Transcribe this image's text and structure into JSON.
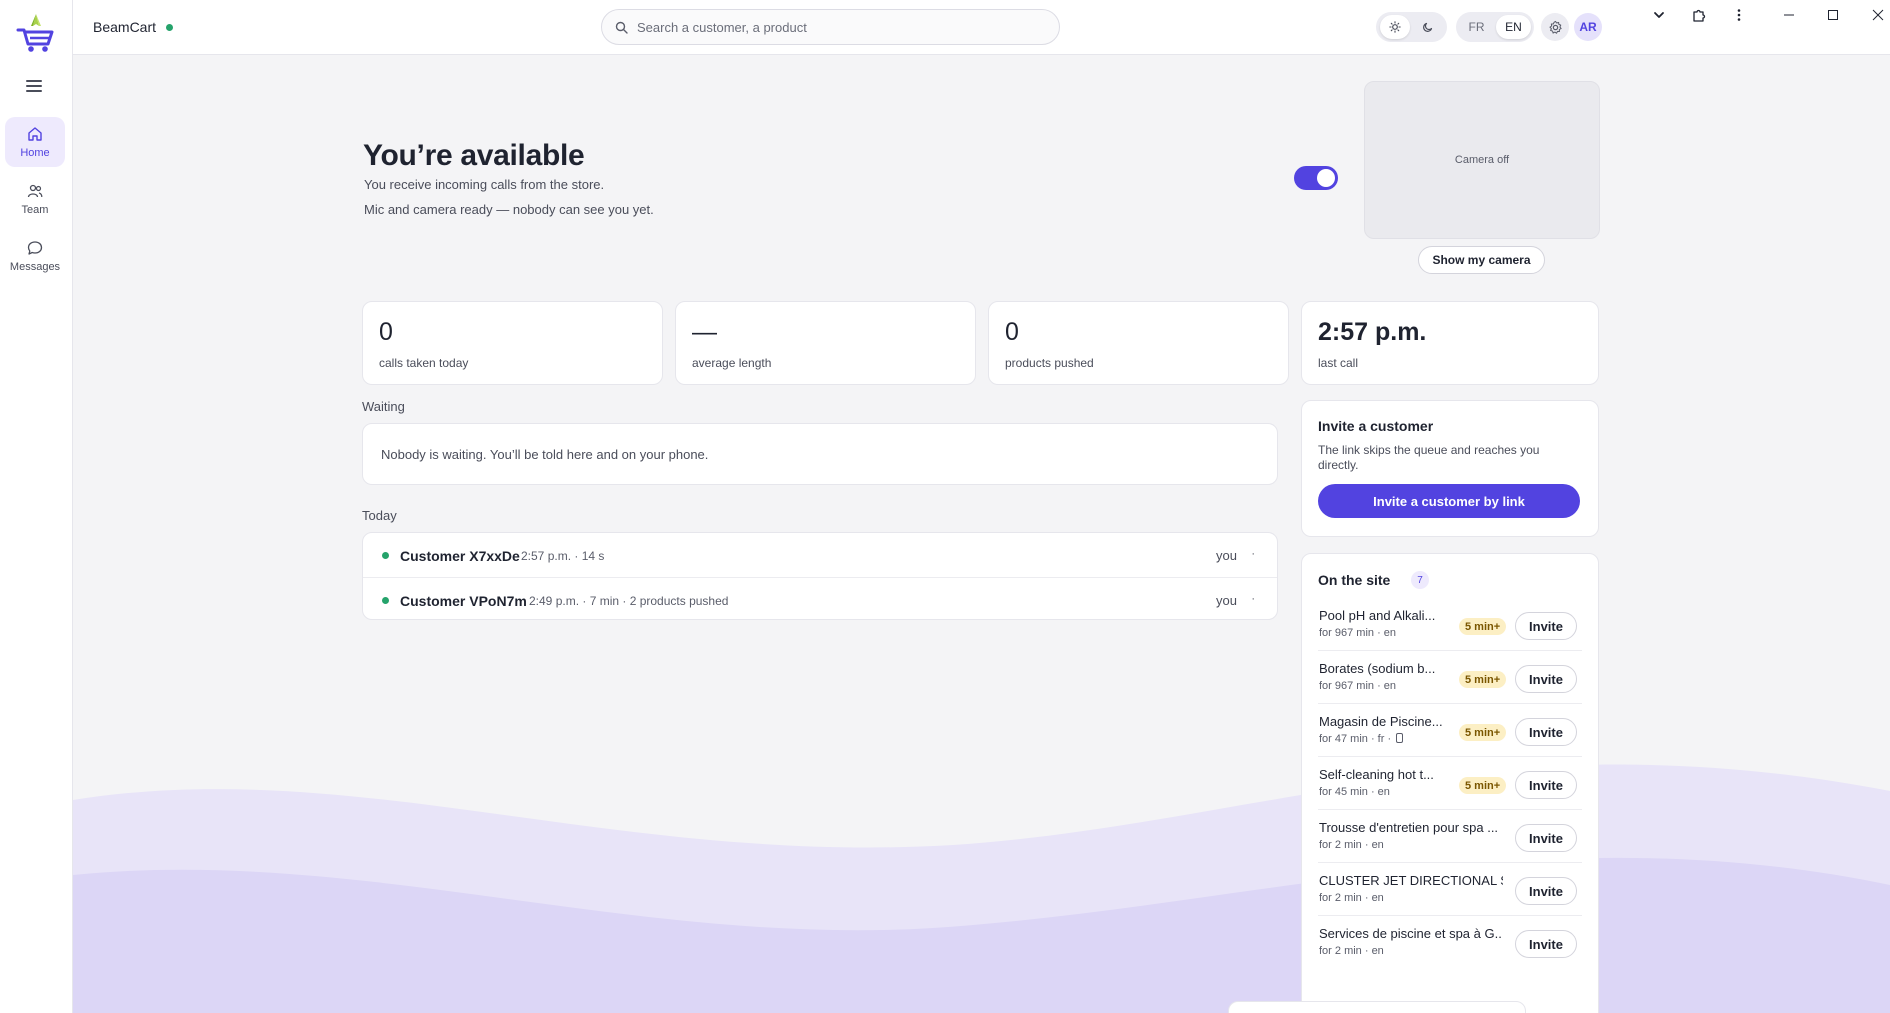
{
  "app": {
    "brand": "BeamCart",
    "colors": {
      "accent": "#5243e0",
      "online": "#25a36b",
      "badge_bg": "#fcefc4"
    }
  },
  "rail": {
    "items": [
      {
        "label": "Home",
        "icon": "home-icon",
        "active": true
      },
      {
        "label": "Team",
        "icon": "team-icon",
        "active": false
      },
      {
        "label": "Messages",
        "icon": "message-icon",
        "active": false
      }
    ]
  },
  "topbar": {
    "search_placeholder": "Search a customer, a product",
    "lang": {
      "fr": "FR",
      "en": "EN",
      "selected": "EN"
    },
    "theme_selected": "light",
    "avatar_initials": "AR"
  },
  "hero": {
    "title": "You’re available",
    "subtitle": "You receive incoming calls from the store.",
    "status": "Mic and camera ready — nobody can see you yet.",
    "available": true,
    "camera_label": "Camera off",
    "show_camera": "Show my camera"
  },
  "stats": [
    {
      "value": "0",
      "caption": "calls taken today"
    },
    {
      "value": "—",
      "caption": "average length"
    },
    {
      "value": "0",
      "caption": "products pushed"
    },
    {
      "value": "2:57 p.m.",
      "caption": "last call"
    }
  ],
  "waiting": {
    "label": "Waiting",
    "empty_text": "Nobody is waiting. You’ll be told here and on your phone."
  },
  "today": {
    "label": "Today",
    "rows": [
      {
        "name": "Customer X7xxDe",
        "meta": "2:57 p.m. · 14 s",
        "who": "you",
        "more": "·"
      },
      {
        "name": "Customer VPoN7m",
        "meta": "2:49 p.m. · 7 min · 2 products pushed",
        "who": "you",
        "more": "·"
      }
    ]
  },
  "invite": {
    "title": "Invite a customer",
    "description": "The link skips the queue and reaches you directly.",
    "button": "Invite a customer by link"
  },
  "on_site": {
    "title": "On the site",
    "count": "7",
    "invite_label": "Invite",
    "rows": [
      {
        "title": "Pool pH and Alkali...",
        "meta": "for 967 min · en",
        "badge": "5 min+",
        "phone": false
      },
      {
        "title": "Borates (sodium b...",
        "meta": "for 967 min · en",
        "badge": "5 min+",
        "phone": false
      },
      {
        "title": "Magasin de Piscine...",
        "meta": "for 47 min · fr ·",
        "badge": "5 min+",
        "phone": true
      },
      {
        "title": "Self-cleaning hot t...",
        "meta": "for 45 min · en",
        "badge": "5 min+",
        "phone": false
      },
      {
        "title": "Trousse d'entretien pour spa ...",
        "meta": "for 2 min · en",
        "badge": "",
        "phone": false
      },
      {
        "title": "CLUSTER JET DIRECTIONAL S...",
        "meta": "for 2 min · en",
        "badge": "",
        "phone": false
      },
      {
        "title": "Services de piscine et spa à G...",
        "meta": "for 2 min · en",
        "badge": "",
        "phone": false
      }
    ]
  }
}
